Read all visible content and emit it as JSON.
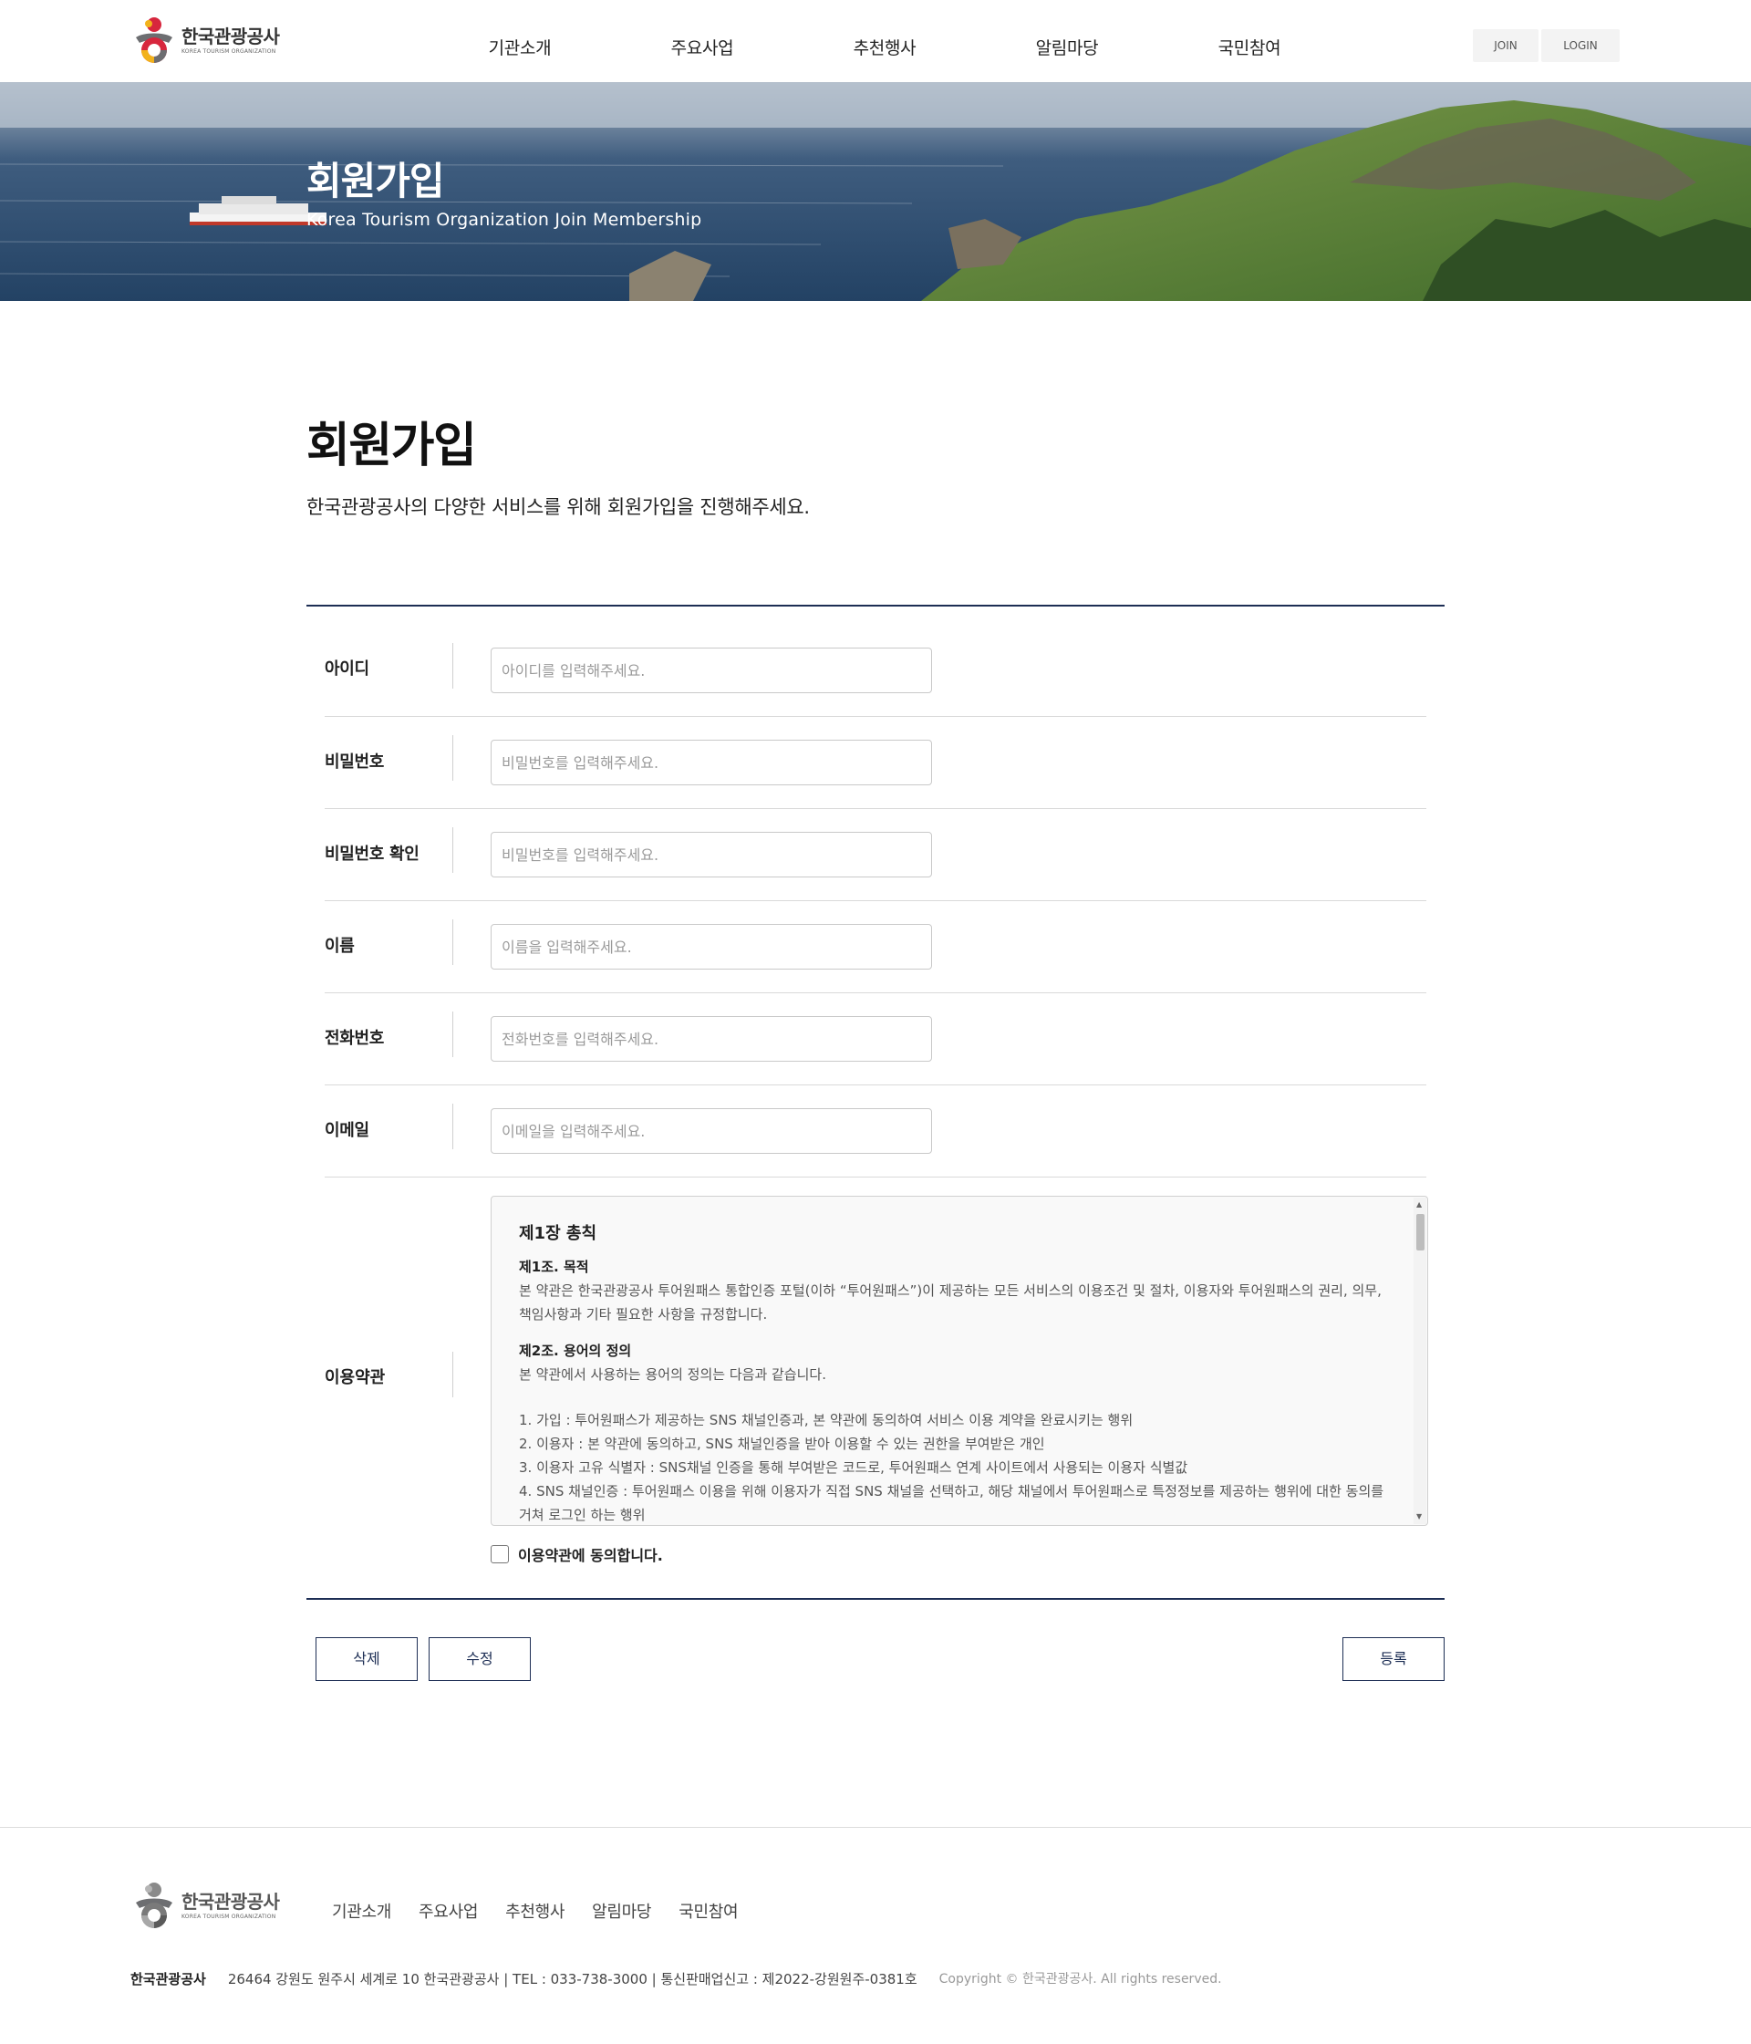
{
  "header": {
    "logo_text_ko": "한국관광공사",
    "logo_text_en": "KOREA TOURISM ORGANIZATION",
    "nav": [
      "기관소개",
      "주요사업",
      "추천행사",
      "알림마당",
      "국민참여"
    ],
    "join_label": "JOIN",
    "login_label": "LOGIN"
  },
  "hero": {
    "title": "회원가입",
    "subtitle": "Korea Tourism Organization Join Membership"
  },
  "page": {
    "title": "회원가입",
    "description": "한국관광공사의 다양한 서비스를 위해 회원가입을 진행해주세요."
  },
  "form": {
    "fields": [
      {
        "label": "아이디",
        "placeholder": "아이디를 입력해주세요.",
        "value": ""
      },
      {
        "label": "비밀번호",
        "placeholder": "비밀번호를 입력해주세요.",
        "value": ""
      },
      {
        "label": "비밀번호 확인",
        "placeholder": "비밀번호를 입력해주세요.",
        "value": ""
      },
      {
        "label": "이름",
        "placeholder": "이름을 입력해주세요.",
        "value": ""
      },
      {
        "label": "전화번호",
        "placeholder": "전화번호를 입력해주세요.",
        "value": ""
      },
      {
        "label": "이메일",
        "placeholder": "이메일을 입력해주세요.",
        "value": ""
      }
    ],
    "terms": {
      "label": "이용약관",
      "chapter": "제1장 총칙",
      "article1_title": "제1조. 목적",
      "article1_body": "본 약관은 한국관광공사 투어원패스 통합인증 포털(이하 “투어원패스”)이 제공하는 모든 서비스의 이용조건 및 절차, 이용자와 투어원패스의 권리, 의무, 책임사항과 기타 필요한 사항을 규정합니다.",
      "article2_title": "제2조. 용어의 정의",
      "article2_body": "본 약관에서 사용하는 용어의 정의는 다음과 같습니다.",
      "definitions": [
        "1. 가입 : 투어원패스가 제공하는 SNS 채널인증과, 본 약관에 동의하여 서비스 이용 계약을 완료시키는 행위",
        "2. 이용자 : 본 약관에 동의하고, SNS 채널인증을 받아 이용할 수 있는 권한을 부여받은 개인",
        "3. 이용자 고유 식별자 : SNS채널 인증을 통해 부여받은 코드로, 투어원패스 연계 사이트에서 사용되는 이용자 식별값",
        "4. SNS 채널인증 : 투어원패스 이용을 위해 이용자가 직접 SNS 채널을 선택하고, 해당 채널에서 투어원패스로 특정정보를 제공하는 행위에 대한 동의를 거쳐 로그인 하는 행위"
      ],
      "agree_label": "이용약관에 동의합니다.",
      "agree_checked": false
    }
  },
  "buttons": {
    "delete": "삭제",
    "modify": "수정",
    "register": "등록"
  },
  "footer": {
    "logo_text_ko": "한국관광공사",
    "logo_text_en": "KOREA TOURISM ORGANIZATION",
    "nav": [
      "기관소개",
      "주요사업",
      "추천행사",
      "알림마당",
      "국민참여"
    ],
    "org": "한국관광공사",
    "address": "26464 강원도 원주시 세계로 10 한국관광공사 | TEL : 033-738-3000 | 통신판매업신고 : 제2022-강원원주-0381호",
    "copyright": "Copyright © 한국관광공사. All rights reserved."
  },
  "colors": {
    "accent": "#1d2e54",
    "logo_red": "#d7263d",
    "logo_yellow": "#f2b21b",
    "logo_gray": "#6d6e71"
  },
  "icons": [
    "logo-mark-icon",
    "checkbox-icon",
    "scroll-up-icon",
    "scroll-down-icon"
  ]
}
